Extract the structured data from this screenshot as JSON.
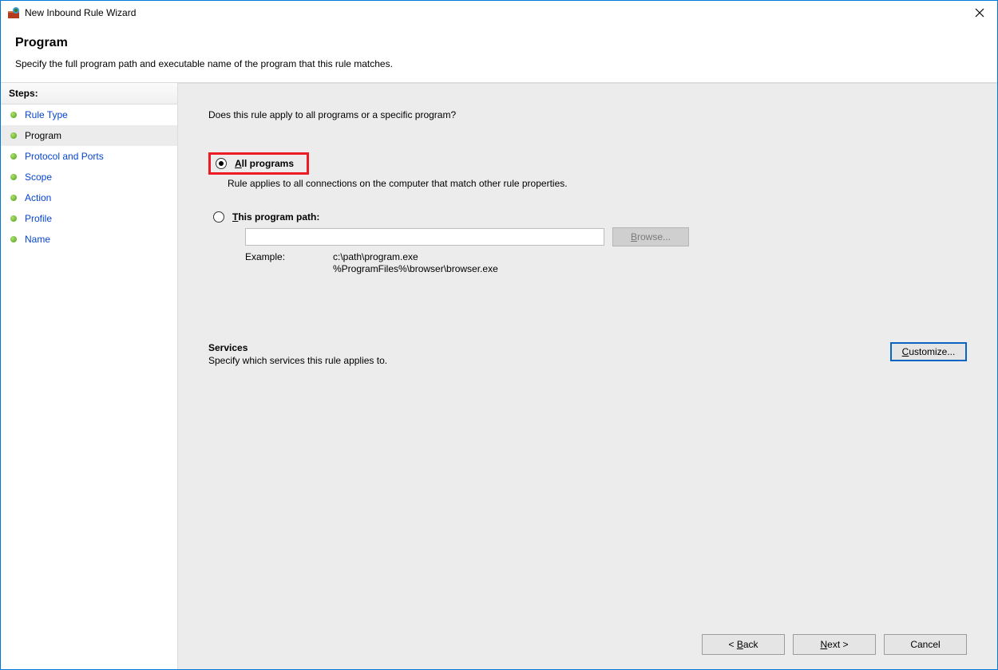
{
  "window": {
    "title": "New Inbound Rule Wizard"
  },
  "header": {
    "title": "Program",
    "description": "Specify the full program path and executable name of the program that this rule matches."
  },
  "sidebar": {
    "heading": "Steps:",
    "items": [
      {
        "label": "Rule Type",
        "active": false
      },
      {
        "label": "Program",
        "active": true
      },
      {
        "label": "Protocol and Ports",
        "active": false
      },
      {
        "label": "Scope",
        "active": false
      },
      {
        "label": "Action",
        "active": false
      },
      {
        "label": "Profile",
        "active": false
      },
      {
        "label": "Name",
        "active": false
      }
    ]
  },
  "main": {
    "prompt": "Does this rule apply to all programs or a specific program?",
    "option_all": {
      "label": "All programs",
      "description": "Rule applies to all connections on the computer that match other rule properties.",
      "selected": true
    },
    "option_path": {
      "label": "This program path:",
      "selected": false,
      "path_value": "",
      "browse_label": "Browse...",
      "example_label": "Example:",
      "example_line1": "c:\\path\\program.exe",
      "example_line2": "%ProgramFiles%\\browser\\browser.exe"
    },
    "services": {
      "heading": "Services",
      "description": "Specify which services this rule applies to.",
      "customize_label": "Customize..."
    }
  },
  "footer": {
    "back": "< Back",
    "next": "Next >",
    "cancel": "Cancel"
  }
}
